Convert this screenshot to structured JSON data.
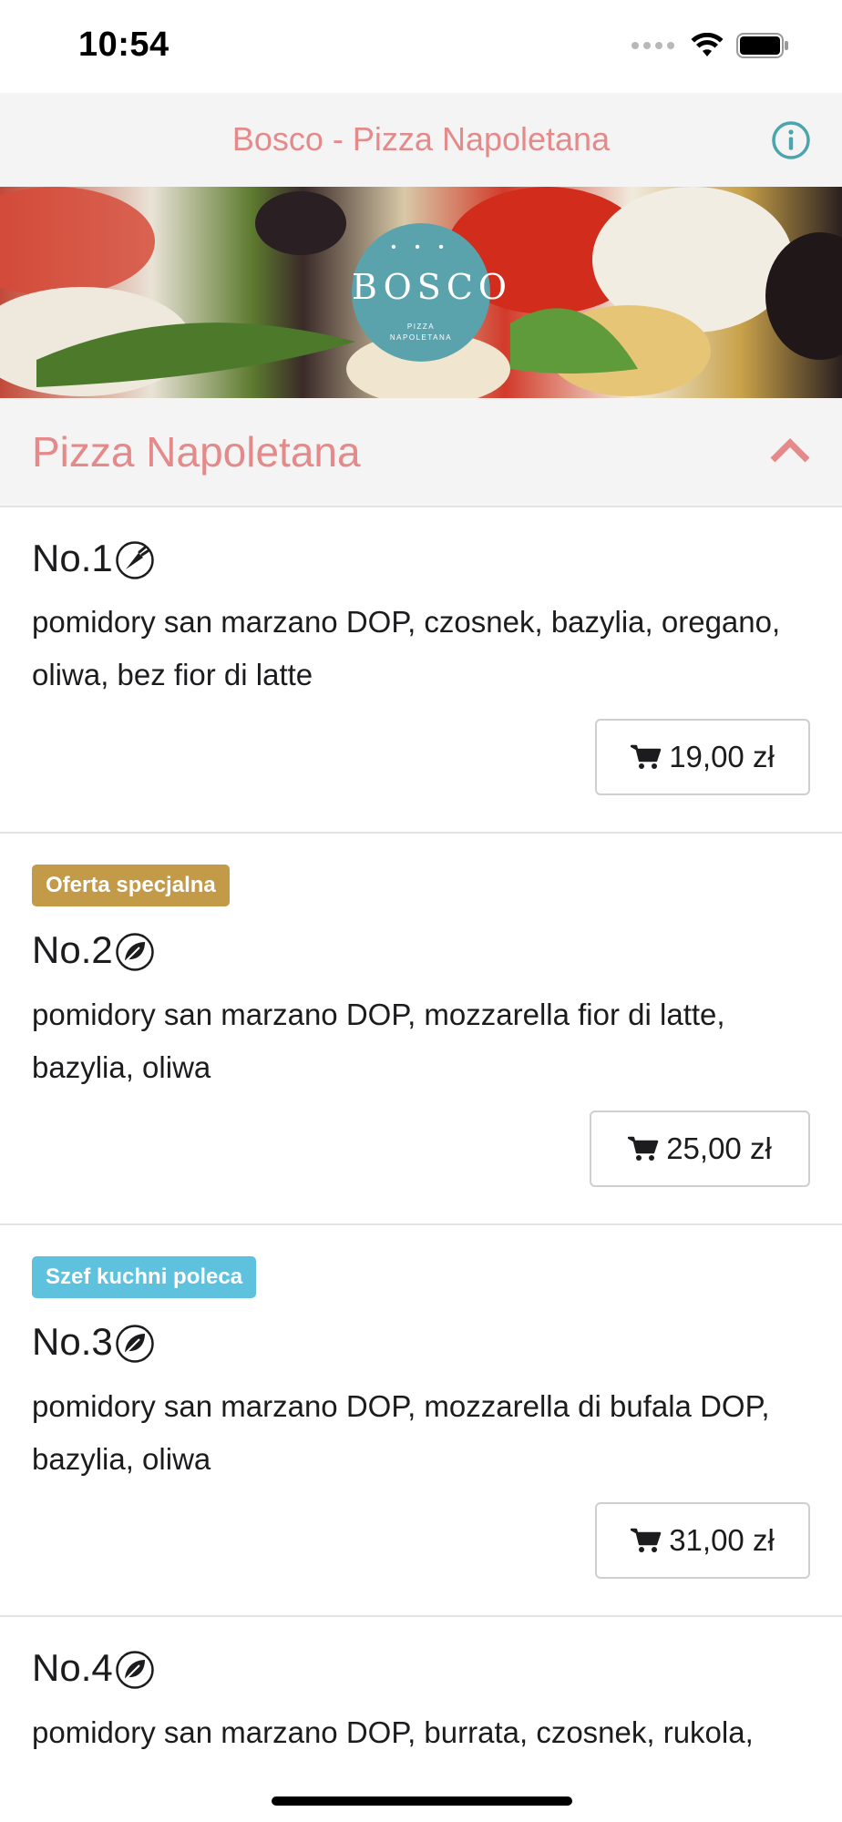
{
  "status_bar": {
    "time": "10:54"
  },
  "nav": {
    "title": "Bosco - Pizza Napoletana"
  },
  "banner": {
    "logo_word": "BOSCO",
    "logo_dots": "• • •",
    "logo_sub_1": "PIZZA",
    "logo_sub_2": "NAPOLETANA"
  },
  "section": {
    "title": "Pizza Napoletana"
  },
  "items": [
    {
      "name": "No.1",
      "icon": "carrot-icon",
      "badge": "",
      "description": "pomidory san marzano DOP, czosnek, bazylia, oregano, oliwa, bez fior di latte",
      "price": "19,00 zł"
    },
    {
      "name": "No.2",
      "icon": "leaf-icon",
      "badge": "Oferta specjalna",
      "description": " pomidory san marzano DOP, mozzarella fior di latte, bazylia, oliwa",
      "price": "25,00 zł"
    },
    {
      "name": "No.3",
      "icon": "leaf-icon",
      "badge": "Szef kuchni poleca",
      "description": " pomidory san marzano DOP, mozzarella di bufala DOP, bazylia, oliwa",
      "price": "31,00 zł"
    },
    {
      "name": "No.4",
      "icon": "leaf-icon",
      "badge": "",
      "description": " pomidory san marzano DOP, burrata, czosnek, rukola,",
      "price": ""
    }
  ],
  "colors": {
    "accent_pink": "#e48a8a",
    "teal": "#5aa3ad",
    "badge_gold": "#c29a48",
    "badge_blue": "#5ec2df"
  }
}
